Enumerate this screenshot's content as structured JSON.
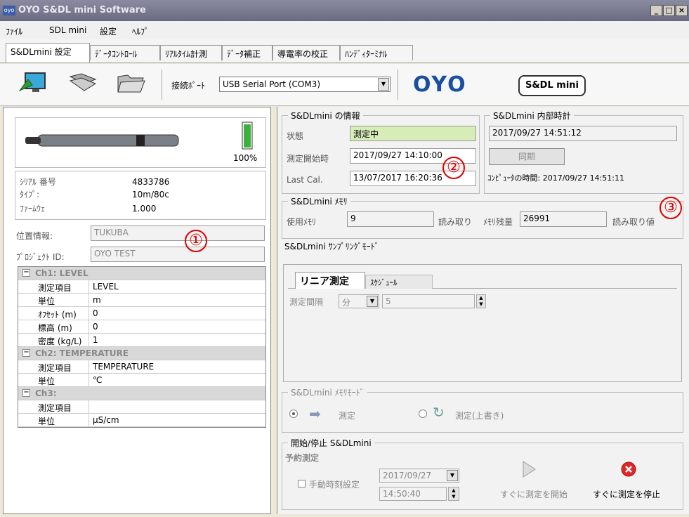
{
  "window": {
    "title": "OYO S&DL mini Software",
    "icon": "app-icon",
    "controls": [
      "_",
      "□",
      "×"
    ]
  },
  "menu": [
    "ﾌｧｲﾙ",
    "SDL mini",
    "設定",
    "ﾍﾙﾌﾟ"
  ],
  "tabs": [
    "S&DLmini 設定",
    "ﾃﾞｰﾀｺﾝﾄﾛｰﾙ",
    "ﾘｱﾙﾀｲﾑ計測",
    "ﾃﾞｰﾀ補正",
    "導電率の校正",
    "ﾊﾝﾃﾞｨﾀｰﾐﾅﾙ"
  ],
  "toolbar": {
    "port_label": "接続ﾎﾟｰﾄ",
    "port_value": "USB Serial Port (COM3)",
    "brand": "OYO",
    "product_logo": "S&DL mini"
  },
  "device": {
    "battery": "100%",
    "serial_label": "ｼﾘｱﾙ 番号",
    "serial_value": "4833786",
    "type_label": "ﾀｲﾌﾟ:",
    "type_value": "10m/80c",
    "firmware_label": "ﾌｧｰﾑｳｪ",
    "firmware_value": "1.000",
    "location_label": "位置情報:",
    "location_value": "TUKUBA",
    "project_label": "ﾌﾟﾛｼﾞｪｸﾄ ID:",
    "project_value": "OYO TEST",
    "marker": "①"
  },
  "grid": [
    {
      "cat": "Ch1: LEVEL"
    },
    {
      "k": "測定項目",
      "v": "LEVEL"
    },
    {
      "k": "単位",
      "v": "m"
    },
    {
      "k": "ｵﾌｾｯﾄ (m)",
      "v": "0"
    },
    {
      "k": "標高 (m)",
      "v": "0"
    },
    {
      "k": "密度 (kg/L)",
      "v": "1"
    },
    {
      "cat": "Ch2: TEMPERATURE"
    },
    {
      "k": "測定項目",
      "v": "TEMPERATURE"
    },
    {
      "k": "単位",
      "v": "℃"
    },
    {
      "cat": "Ch3:"
    },
    {
      "k": "測定項目",
      "v": ""
    },
    {
      "k": "単位",
      "v": "μS/cm"
    }
  ],
  "info": {
    "title": "S&DLmini の情報",
    "state_label": "状態",
    "state_value": "測定中",
    "start_label": "測定開始時",
    "start_value": "2017/09/27 14:10:00",
    "cal_label": "Last Cal.",
    "cal_value": "13/07/2017 16:20:36",
    "marker": "②"
  },
  "clock": {
    "title": "S&DLmini 内部時計",
    "value": "2017/09/27 14:51:12",
    "sync": "同期",
    "pc_time": "ｺﾝﾋﾟｭｰﾀの時間: 2017/09/27 14:51:11"
  },
  "memory": {
    "title": "S&DLmini ﾒﾓﾘ",
    "used_label": "使用ﾒﾓﾘ",
    "used_value": "9",
    "read_label": "読み取り",
    "remain_label": "ﾒﾓﾘ残量",
    "remain_value": "26991",
    "read_value_label": "読み取り値",
    "marker": "③"
  },
  "sampling": {
    "title": "S&DLmini ｻﾝﾌﾟﾘﾝｸﾞﾓｰﾄﾞ",
    "tab_linear": "リニア測定",
    "tab_schedule": "ｽｹｼﾞｭｰﾙ",
    "interval_label": "測定間隔",
    "unit": "分",
    "interval_value": "5"
  },
  "memmode": {
    "title": "S&DLmini ﾒﾓﾘﾓｰﾄﾞ",
    "opt1": "測定",
    "opt2": "測定(上書き)"
  },
  "startstop": {
    "title": "開始/停止 S&DLmini",
    "reserve": "予約測定",
    "manual": "手動時刻設定",
    "date": "2017/09/27",
    "time": "14:50:40",
    "start_now": "すぐに測定を開始",
    "stop_now": "すぐに測定を停止"
  }
}
